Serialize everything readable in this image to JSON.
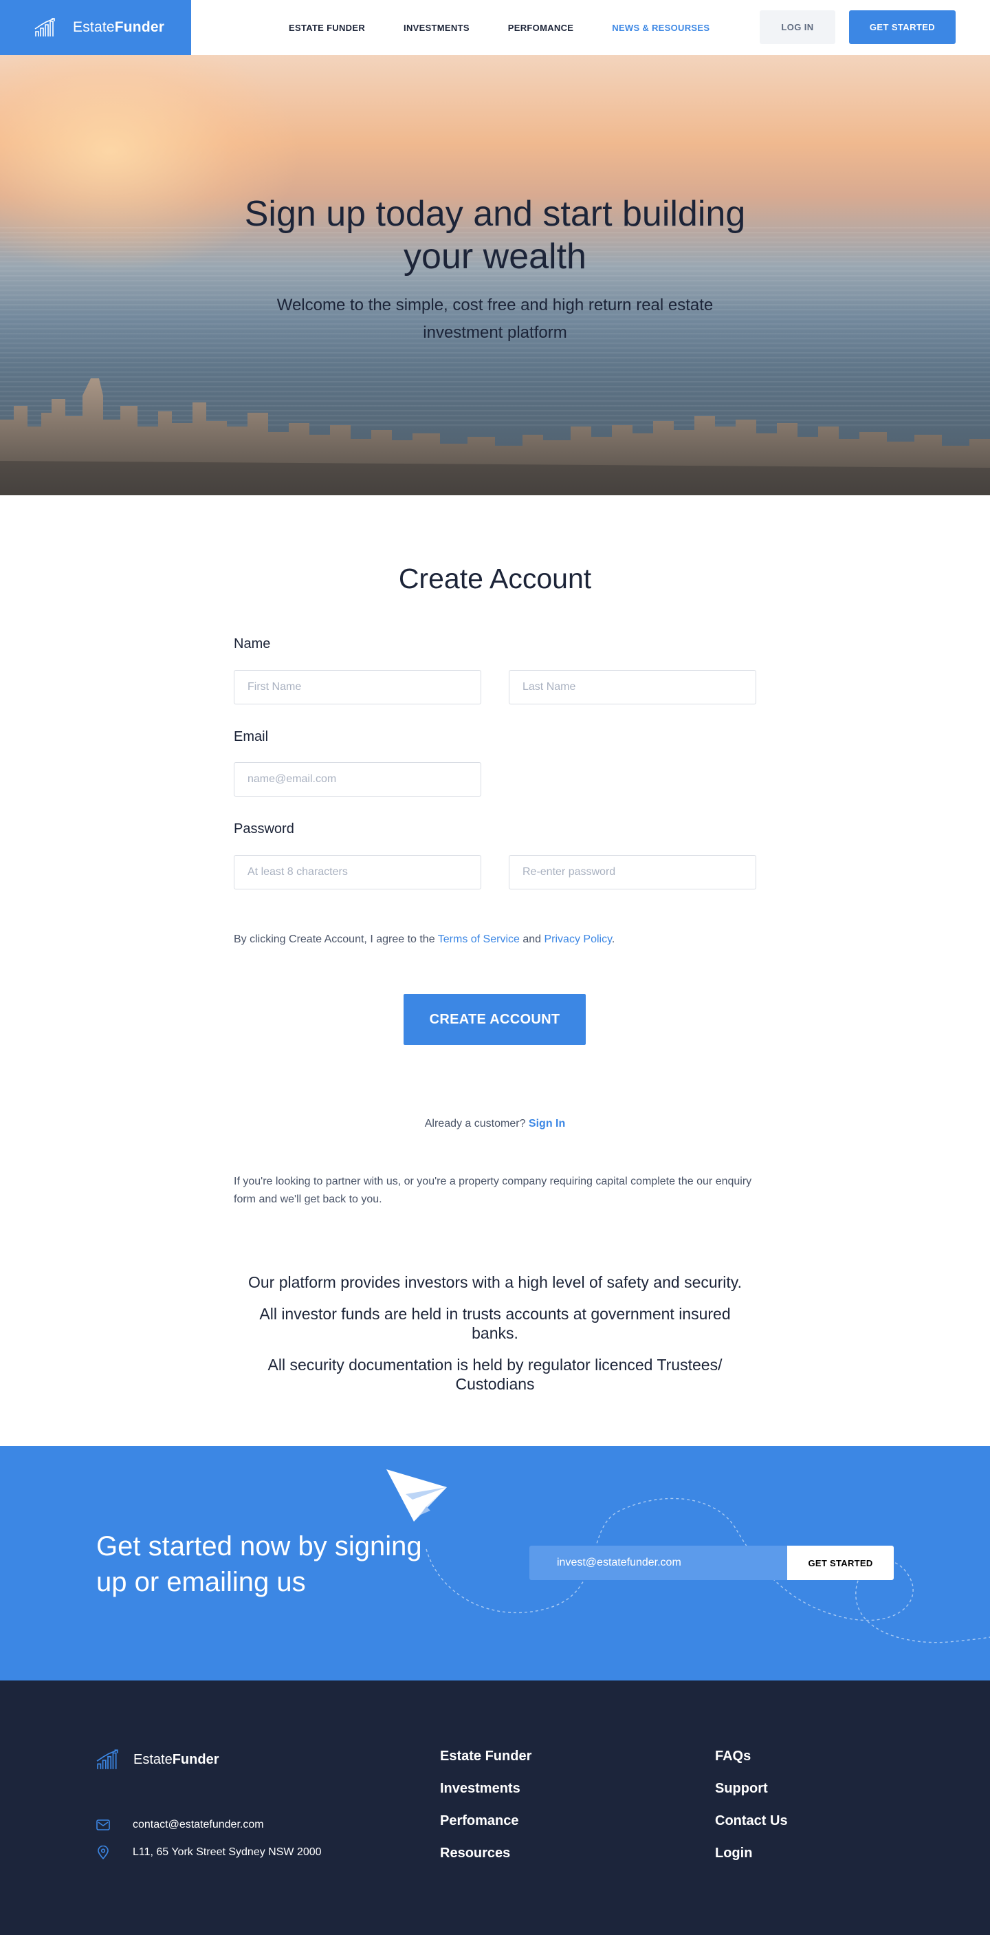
{
  "brand": {
    "name_light": "Estate",
    "name_bold": "Funder"
  },
  "nav": {
    "items": [
      {
        "label": "ESTATE FUNDER"
      },
      {
        "label": "INVESTMENTS"
      },
      {
        "label": "PERFOMANCE"
      },
      {
        "label": "NEWS & RESOURSES",
        "active": true
      }
    ],
    "login_label": "LOG IN",
    "get_started_label": "GET STARTED"
  },
  "hero": {
    "title": "Sign up today and start building your wealth",
    "subtitle": "Welcome to the simple, cost free and high return real estate investment platform"
  },
  "form": {
    "title": "Create Account",
    "name_label": "Name",
    "first_name_placeholder": "First Name",
    "last_name_placeholder": "Last Name",
    "email_label": "Email",
    "email_placeholder": "name@email.com",
    "password_label": "Password",
    "password_placeholder": "At least 8 characters",
    "password_confirm_placeholder": "Re-enter password",
    "terms_prefix": "By clicking Create Account, I agree to the ",
    "terms_link": "Terms of Service",
    "terms_and": " and ",
    "privacy_link": "Privacy Policy",
    "terms_suffix": ".",
    "submit_label": "CREATE ACCOUNT",
    "already_text": "Already a customer? ",
    "sign_in_link": "Sign In",
    "partner_text": "If you're looking to partner with us, or you're a property company requiring capital complete the our enquiry form and we'll get back to you."
  },
  "security": {
    "line1": "Our platform provides investors with a high level of safety and security.",
    "line2": "All investor funds are held in trusts accounts at government insured banks.",
    "line3": "All security documentation is held by regulator licenced Trustees/ Custodians"
  },
  "cta": {
    "title": "Get started now by signing up or emailing us",
    "email_placeholder": "invest@estatefunder.com",
    "button_label": "GET STARTED"
  },
  "footer": {
    "email": "contact@estatefunder.com",
    "address": "L11, 65 York Street Sydney NSW 2000",
    "col1": [
      "Estate Funder",
      "Investments",
      "Perfomance",
      "Resources"
    ],
    "col2": [
      "FAQs",
      "Support",
      "Contact Us",
      "Login"
    ]
  },
  "colors": {
    "accent": "#3c87e4",
    "dark_text": "#1c2438",
    "footer_bg": "#1c253b"
  }
}
